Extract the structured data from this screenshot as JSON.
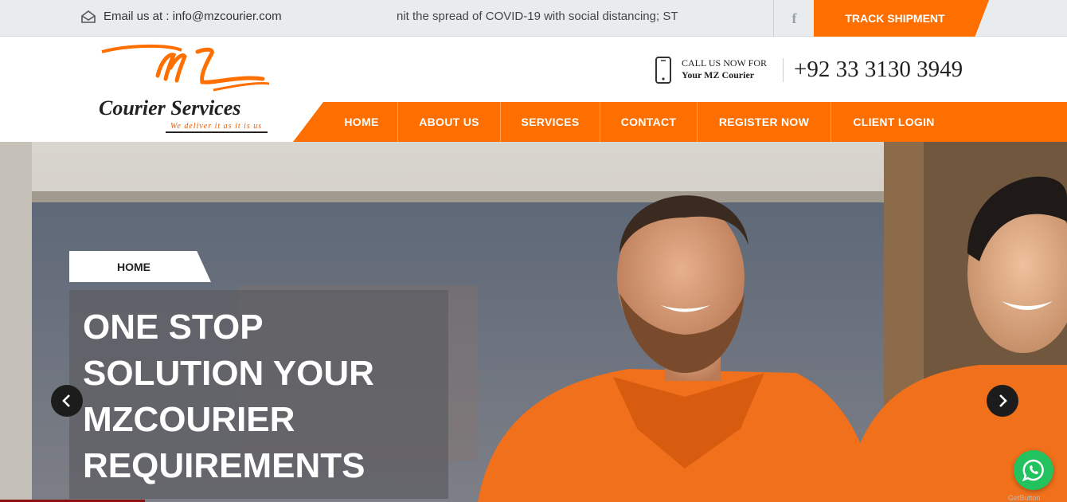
{
  "topbar": {
    "email_label": "Email us at : info@mzcourier.com",
    "ticker_text": "nit the spread of COVID-19 with social distancing; ST",
    "facebook_glyph": "f",
    "track_label": "TRACK SHIPMENT"
  },
  "header": {
    "logo": {
      "text": "Courier Services",
      "tagline": "We deliver it as it is us"
    },
    "call_line1": "CALL US NOW FOR",
    "call_line2": "Your MZ Courier",
    "phone": "+92 33 3130 3949"
  },
  "nav": {
    "items": [
      {
        "label": "HOME"
      },
      {
        "label": "ABOUT US"
      },
      {
        "label": "SERVICES"
      },
      {
        "label": "CONTACT"
      },
      {
        "label": "REGISTER NOW"
      },
      {
        "label": "CLIENT LOGIN"
      }
    ]
  },
  "hero": {
    "breadcrumb": "HOME",
    "headline": [
      "ONE STOP",
      "SOLUTION YOUR",
      "MZCOURIER",
      "REQUIREMENTS"
    ]
  },
  "widgets": {
    "getbutton_label": "GetButton"
  },
  "colors": {
    "accent": "#ff6f00",
    "topbar_bg": "#e9ecef",
    "whatsapp": "#22c35e"
  },
  "icons": [
    "envelope-icon",
    "facebook-icon",
    "mobile-phone-icon",
    "chevron-left-icon",
    "chevron-right-icon",
    "whatsapp-icon"
  ]
}
